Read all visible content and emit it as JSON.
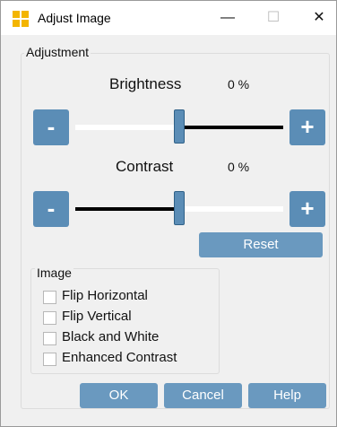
{
  "window": {
    "title": "Adjust Image",
    "minimize": "—",
    "maximize": "☐",
    "close": "✕"
  },
  "adjustment": {
    "label": "Adjustment",
    "brightness": {
      "label": "Brightness",
      "value": "0 %",
      "level": 0
    },
    "contrast": {
      "label": "Contrast",
      "value": "0 %",
      "level": 0
    },
    "minus": "-",
    "plus": "+",
    "reset": "Reset"
  },
  "image": {
    "label": "Image",
    "options": [
      "Flip Horizontal",
      "Flip Vertical",
      "Black and White",
      "Enhanced Contrast"
    ]
  },
  "footer": {
    "ok": "OK",
    "cancel": "Cancel",
    "help": "Help"
  },
  "colors": {
    "accent": "#5b8db6",
    "button": "#6a99bf",
    "icon": "#f3b500"
  }
}
